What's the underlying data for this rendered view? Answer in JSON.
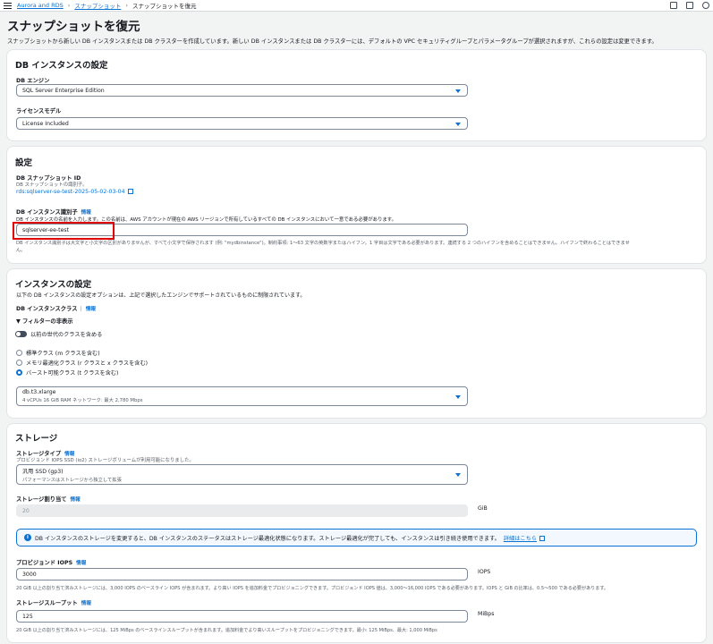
{
  "breadcrumb": {
    "items": [
      "Aurora and RDS",
      "スナップショット",
      "スナップショットを復元"
    ]
  },
  "page": {
    "title": "スナップショットを復元",
    "description": "スナップショットから新しい DB インスタンスまたは DB クラスターを作成しています。新しい DB インスタンスまたは DB クラスターには、デフォルトの VPC セキュリティグループとパラメータグループが選択されますが、これらの設定は変更できます。"
  },
  "db_settings": {
    "title": "DB インスタンスの設定",
    "engine_label": "DB エンジン",
    "engine_value": "SQL Server Enterprise Edition",
    "license_label": "ライセンスモデル",
    "license_value": "License Included"
  },
  "settings": {
    "title": "設定",
    "snapshot_id_label": "DB スナップショット ID",
    "snapshot_id_desc": "DB スナップショットの識別子。",
    "snapshot_id_value": "rds:sqlserver-se-test-2025-05-02-03-04",
    "identifier_label": "DB インスタンス識別子",
    "info": "情報",
    "identifier_desc": "DB インスタンスの名前を入力します。この名前は、AWS アカウントが現在の AWS リージョンで所有しているすべての DB インスタンスにおいて一意である必要があります。",
    "identifier_value": "sqlserver-ee-test",
    "identifier_hint_1": "DB インスタンス識別子は大文字と小文字の区別がありませんが、すべて小文字で保存されます (例: \"mydbinstance\")。制約事項: 1～63 文字の英数字またはハイフン。1 字目は文字である必要があります。連続する 2 つのハイフンを含めることはできません。ハイフンで終わることはできませ",
    "identifier_hint_2": "ん。"
  },
  "instance": {
    "title": "インスタンスの設定",
    "desc": "以下の DB インスタンスの設定オプションは、上記で選択したエンジンでサポートされているものに制限されています。",
    "class_label": "DB インスタンスクラス",
    "info": "情報",
    "filter_label": "▼ フィルターの非表示",
    "toggle_label": "以前の世代のクラスを含める",
    "radio_standard": "標準クラス (m クラスを含む)",
    "radio_memory": "メモリ最適化クラス (r クラスと x クラスを含む)",
    "radio_burst": "バースト可能クラス (t クラスを含む)",
    "class_value": "db.t3.xlarge",
    "class_detail": "4 vCPUs    16 GiB RAM    ネットワーク: 最大 2,780 Mbps"
  },
  "storage": {
    "title": "ストレージ",
    "type_label": "ストレージタイプ",
    "info": "情報",
    "type_desc": "プロビジョンド IOPS SSD (io2) ストレージボリュームが利用可能になりました。",
    "type_value": "汎用 SSD (gp3)",
    "type_sub": "パフォーマンスはストレージから独立して拡張",
    "alloc_label": "ストレージ割り当て",
    "alloc_value": "20",
    "alloc_unit": "GiB",
    "alert_text": "DB インスタンスのストレージを変更すると、DB インスタンスのステータスはストレージ最適化状態になります。ストレージ最適化が完了しても、インスタンスは引き続き使用できます。",
    "alert_link": "詳細はこちら",
    "iops_label": "プロビジョンド IOPS",
    "iops_value": "3000",
    "iops_unit": "IOPS",
    "iops_hint": "20 GiB 以上の割り当て済みストレージには、3,000 IOPS のベースライン IOPS が含まれます。より高い IOPS を追加料金でプロビジョニングできます。プロビジョンド IOPS 値は、3,000～16,000 IOPS である必要があります。IOPS と GiB の比率は、0.5～500 である必要があります。",
    "throughput_label": "ストレージスループット",
    "throughput_value": "125",
    "throughput_unit": "MiBps",
    "throughput_hint": "20 GiB 以上の割り当て済みストレージには、125 MiBps のベースラインスループットが含まれます。追加料金でより高いスループットをプロビジョニングできます。最小: 125 MiBps、最大: 1,000 MiBps"
  }
}
